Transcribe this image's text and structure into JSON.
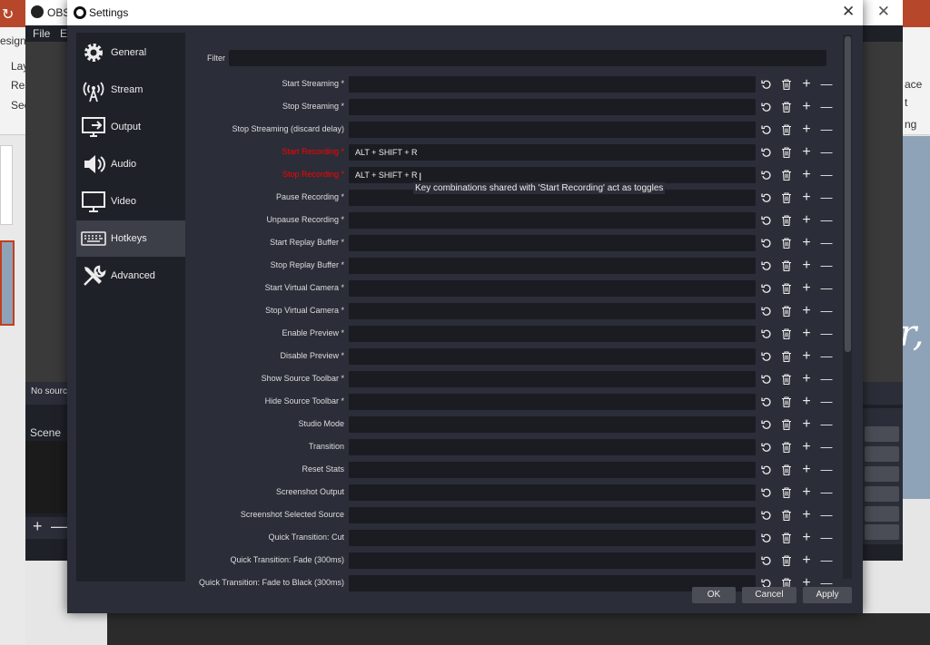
{
  "ppt": {
    "tab_fragment": "esign",
    "ribbon_items": [
      "Lay",
      "Res",
      "Sec"
    ],
    "ribbon_right": [
      "ace",
      "t",
      "ng"
    ],
    "slide_glyphs": "r,"
  },
  "obs": {
    "title": "OBS",
    "menu": [
      "File",
      "E"
    ],
    "no_source": "No source",
    "scene_header": "Scene",
    "add_label": "+",
    "remove_label": "—"
  },
  "dialog": {
    "title": "Settings",
    "close_label": "✕",
    "sidebar": [
      {
        "label": "General",
        "icon": "gear-icon",
        "active": false
      },
      {
        "label": "Stream",
        "icon": "antenna-icon",
        "active": false
      },
      {
        "label": "Output",
        "icon": "monitor-output-icon",
        "active": false
      },
      {
        "label": "Audio",
        "icon": "speaker-icon",
        "active": false
      },
      {
        "label": "Video",
        "icon": "monitor-icon",
        "active": false
      },
      {
        "label": "Hotkeys",
        "icon": "keyboard-icon",
        "active": true
      },
      {
        "label": "Advanced",
        "icon": "tools-icon",
        "active": false
      }
    ],
    "filter_label": "Filter",
    "filter_value": "",
    "hotkeys": [
      {
        "label": "Start Streaming *",
        "value": "",
        "highlight": false
      },
      {
        "label": "Stop Streaming *",
        "value": "",
        "highlight": false
      },
      {
        "label": "Stop Streaming (discard delay)",
        "value": "",
        "highlight": false
      },
      {
        "label": "Start Recording *",
        "value": "ALT + SHIFT + R",
        "highlight": true
      },
      {
        "label": "Stop Recording *",
        "value": "ALT + SHIFT + R",
        "highlight": true
      },
      {
        "label": "Pause Recording *",
        "value": "",
        "highlight": false
      },
      {
        "label": "Unpause Recording *",
        "value": "",
        "highlight": false
      },
      {
        "label": "Start Replay Buffer *",
        "value": "",
        "highlight": false
      },
      {
        "label": "Stop Replay Buffer *",
        "value": "",
        "highlight": false
      },
      {
        "label": "Start Virtual Camera *",
        "value": "",
        "highlight": false
      },
      {
        "label": "Stop Virtual Camera *",
        "value": "",
        "highlight": false
      },
      {
        "label": "Enable Preview *",
        "value": "",
        "highlight": false
      },
      {
        "label": "Disable Preview *",
        "value": "",
        "highlight": false
      },
      {
        "label": "Show Source Toolbar *",
        "value": "",
        "highlight": false
      },
      {
        "label": "Hide Source Toolbar *",
        "value": "",
        "highlight": false
      },
      {
        "label": "Studio Mode",
        "value": "",
        "highlight": false
      },
      {
        "label": "Transition",
        "value": "",
        "highlight": false
      },
      {
        "label": "Reset Stats",
        "value": "",
        "highlight": false
      },
      {
        "label": "Screenshot Output",
        "value": "",
        "highlight": false
      },
      {
        "label": "Screenshot Selected Source",
        "value": "",
        "highlight": false
      },
      {
        "label": "Quick Transition: Cut",
        "value": "",
        "highlight": false
      },
      {
        "label": "Quick Transition: Fade (300ms)",
        "value": "",
        "highlight": false
      },
      {
        "label": "Quick Transition: Fade to Black (300ms)",
        "value": "",
        "highlight": false
      }
    ],
    "tooltip": "Key combinations shared with 'Start Recording' act as toggles",
    "row_buttons": {
      "revert": "revert-icon",
      "delete": "trash-icon",
      "add": "+",
      "remove": "—"
    },
    "footer": {
      "ok": "OK",
      "cancel": "Cancel",
      "apply": "Apply"
    },
    "colors": {
      "bg": "#2b2e38",
      "sidebar": "#1f2129",
      "input": "#1b1c22",
      "conflict": "#ff0000"
    }
  }
}
